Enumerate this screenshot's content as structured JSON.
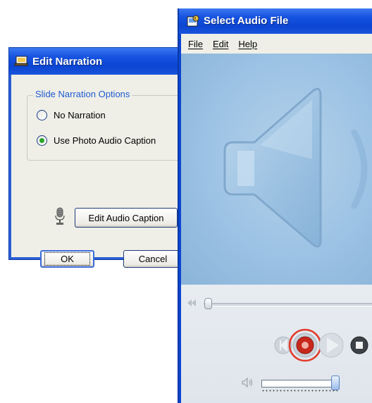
{
  "edit_narration": {
    "title": "Edit Narration",
    "group_label": "Slide Narration Options",
    "options": [
      {
        "label": "No Narration",
        "selected": false
      },
      {
        "label": "Use Photo Audio Caption",
        "selected": true
      }
    ],
    "edit_button": "Edit Audio Caption",
    "ok_button": "OK",
    "cancel_button": "Cancel"
  },
  "select_audio": {
    "title": "Select Audio File",
    "menu": [
      "File",
      "Edit",
      "Help"
    ],
    "icons": [
      "speaker-icon",
      "rewind-icon",
      "skip-back-icon",
      "record-icon",
      "play-icon",
      "stop-icon",
      "volume-icon"
    ],
    "seek_position": 0.0,
    "volume_level": 0.92,
    "highlight_color": "#e23a2a"
  }
}
